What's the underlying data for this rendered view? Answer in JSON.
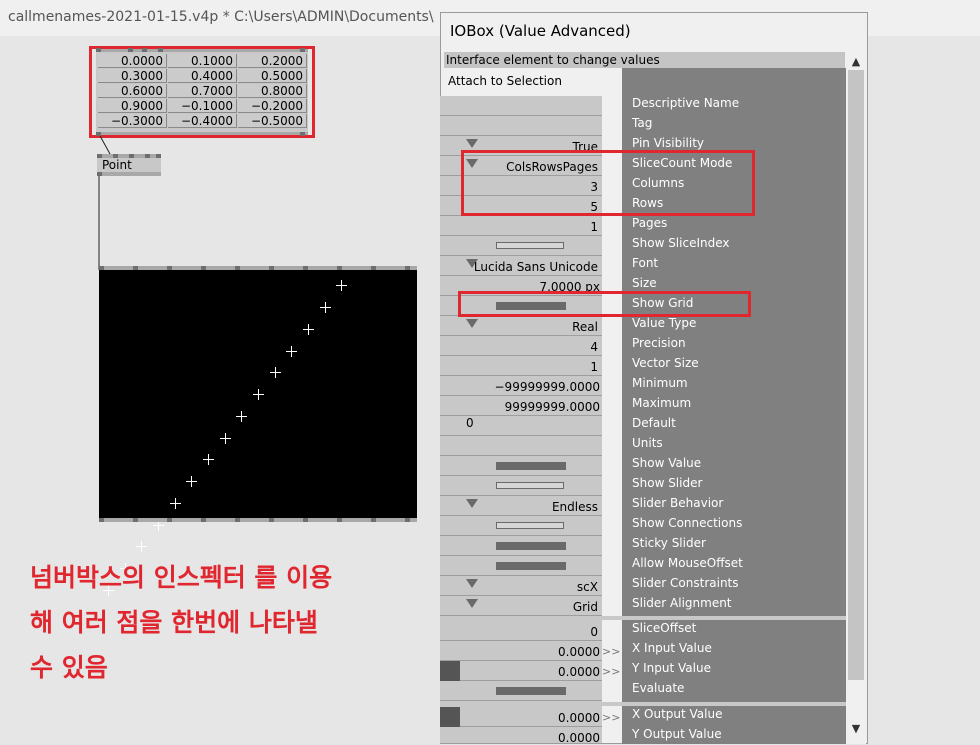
{
  "window": {
    "file_title": "callmenames-2021-01-15.v4p *   C:\\Users\\ADMIN\\Documents\\"
  },
  "iobox": {
    "values": [
      [
        "0.0000",
        "0.1000",
        "0.2000"
      ],
      [
        "0.3000",
        "0.4000",
        "0.5000"
      ],
      [
        "0.6000",
        "0.7000",
        "0.8000"
      ],
      [
        "0.9000",
        "−0.1000",
        "−0.2000"
      ],
      [
        "−0.3000",
        "−0.4000",
        "−0.5000"
      ]
    ]
  },
  "point_node": {
    "label": "Point"
  },
  "renderer": {
    "points": [
      [
        -0.9,
        -0.9
      ],
      [
        -0.8,
        -0.8
      ],
      [
        -0.7,
        -0.7
      ],
      [
        -0.6,
        -0.6
      ],
      [
        -0.5,
        -0.5
      ],
      [
        -0.4,
        -0.4
      ],
      [
        -0.3,
        -0.3
      ],
      [
        -0.2,
        -0.2
      ],
      [
        -0.1,
        -0.1
      ],
      [
        0.0,
        0.0
      ],
      [
        0.1,
        0.1
      ],
      [
        0.2,
        0.2
      ],
      [
        0.3,
        0.3
      ],
      [
        0.4,
        0.4
      ],
      [
        0.5,
        0.5
      ]
    ]
  },
  "annotation": {
    "line1": "넘버박스의 인스펙터 를 이용",
    "line2": "해 여러 점을 한번에 나타낼",
    "line3": "수 있음"
  },
  "inspector": {
    "title": "IOBox (Value Advanced)",
    "description": "Interface element to change values",
    "attach": "Attach to Selection",
    "labels": {
      "descriptive_name": "Descriptive Name",
      "tag": "Tag",
      "pin_visibility": "Pin Visibility",
      "slicecount_mode": "SliceCount Mode",
      "columns": "Columns",
      "rows": "Rows",
      "pages": "Pages",
      "show_sliceindex": "Show SliceIndex",
      "font": "Font",
      "size": "Size",
      "show_grid": "Show Grid",
      "value_type": "Value Type",
      "precision": "Precision",
      "vector_size": "Vector Size",
      "minimum": "Minimum",
      "maximum": "Maximum",
      "default": "Default",
      "units": "Units",
      "show_value": "Show Value",
      "show_slider": "Show Slider",
      "slider_behavior": "Slider Behavior",
      "show_connections": "Show Connections",
      "sticky_slider": "Sticky Slider",
      "allow_mouseoffset": "Allow MouseOffset",
      "slider_constraints": "Slider Constraints",
      "slider_alignment": "Slider Alignment",
      "sliceoffset": "SliceOffset",
      "x_input_value": "X Input Value",
      "y_input_value": "Y Input Value",
      "evaluate": "Evaluate",
      "x_output_value": "X Output Value",
      "y_output_value": "Y Output Value"
    },
    "values": {
      "pin_visibility": "True",
      "slicecount_mode": "ColsRowsPages",
      "columns": "3",
      "rows": "5",
      "pages": "1",
      "font": "Lucida Sans Unicode",
      "size": "7.0000 px",
      "value_type": "Real",
      "precision": "4",
      "vector_size": "1",
      "minimum": "−99999999.0000",
      "maximum": "99999999.0000",
      "default": "0",
      "slider_behavior": "Endless",
      "slider_constraints": "scX",
      "slider_alignment": "Grid",
      "sliceoffset": "0",
      "x_input_value": "0.0000",
      "y_input_value": "0.0000",
      "x_output_value": "0.0000",
      "y_output_value": "0.0000",
      "arrow": ">>"
    },
    "scroll_up": "▲",
    "scroll_down": "▼"
  }
}
